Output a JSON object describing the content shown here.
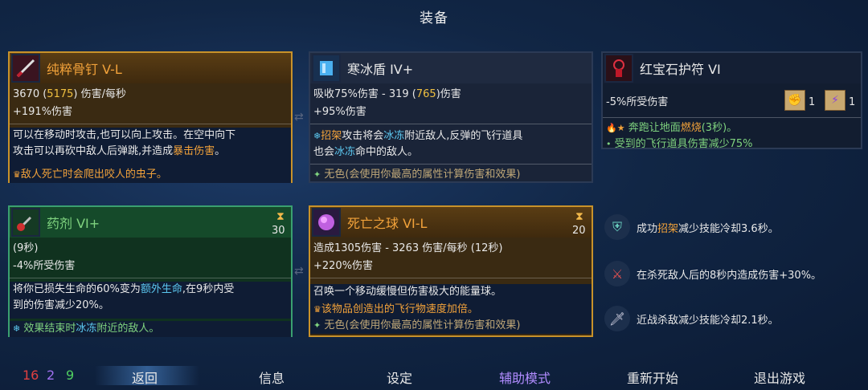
{
  "title": "装备",
  "colors": {
    "orange": "#f2a23a",
    "gold": "#f0c040",
    "cyan": "#5cc8f0",
    "green": "#7fd37f",
    "purple": "#b18cff"
  },
  "cards": {
    "weapon1": {
      "name": "纯粹骨钉  V-L",
      "dmg_prefix": "3670 (",
      "dmg_high": "5175",
      "dmg_suffix": ") 伤害/每秒",
      "bonus": "+191%伤害",
      "desc1": "可以在移动时攻击,也可以向上攻击。在空中向下",
      "desc2_a": "攻击可以再砍中敌人后弹跳,并造成",
      "desc2_b": "暴击伤害",
      "desc2_c": "。",
      "affix": "敌人死亡时会爬出咬人的虫子。"
    },
    "shield": {
      "name": "寒冰盾  IV+",
      "stat1_a": "吸收75%伤害 - 319 (",
      "stat1_b": "765",
      "stat1_c": ")伤害",
      "stat2": "+95%伤害",
      "desc1_a": "招架",
      "desc1_b": "攻击将会",
      "desc1_c": "冰冻",
      "desc1_d": "附近敌人,反弹的飞行道具",
      "desc2_a": "也会",
      "desc2_b": "冰冻",
      "desc2_c": "命中的敌人。",
      "colorless": "无色(会使用你最高的属性计算伤害和效果)"
    },
    "amulet": {
      "name": "红宝石护符  VI",
      "stat": "-5%所受伤害",
      "count1": "1",
      "count2": "1",
      "aff1_a": "奔跑让地面",
      "aff1_b": "燃烧",
      "aff1_c": "(3秒)。",
      "aff2": "受到的飞行道具伤害减少75%"
    },
    "potion": {
      "name": "药剂  VI+",
      "cooldown": "30",
      "stat1": "(9秒)",
      "stat2": "-4%所受伤害",
      "desc1_a": "将你已损失生命的60%变为",
      "desc1_b": "额外生命",
      "desc1_c": ",在9秒内受",
      "desc2": "到的伤害减少20%。",
      "affix_a": "效果结束时",
      "affix_b": "冰冻",
      "affix_c": "附近的敌人。"
    },
    "orb": {
      "name": "死亡之球  VI-L",
      "cooldown": "20",
      "stat1": "造成1305伤害 - 3263 伤害/每秒 (12秒)",
      "stat2": "+220%伤害",
      "desc": "召唤一个移动缓慢但伤害极大的能量球。",
      "affix": "该物品创造出的飞行物速度加倍。",
      "colorless": "无色(会使用你最高的属性计算伤害和效果)"
    }
  },
  "mutations": [
    {
      "icon": "parry-shield-icon",
      "a": "成功",
      "b": "招架",
      "c": "减少技能冷却3.6秒。"
    },
    {
      "icon": "crossed-swords-icon",
      "a": "在杀死敌人后的8秒内造成伤害+30%。",
      "b": "",
      "c": ""
    },
    {
      "icon": "blade-icon",
      "a": "近战杀敌减少技能冷却2.1秒。",
      "b": "",
      "c": ""
    }
  ],
  "stats": {
    "brutality": "16",
    "tactics": "2",
    "survival": "9"
  },
  "menu": {
    "back": "返回",
    "info": "信息",
    "settings": "设定",
    "assist": "辅助模式",
    "restart": "重新开始",
    "quit": "退出游戏"
  }
}
